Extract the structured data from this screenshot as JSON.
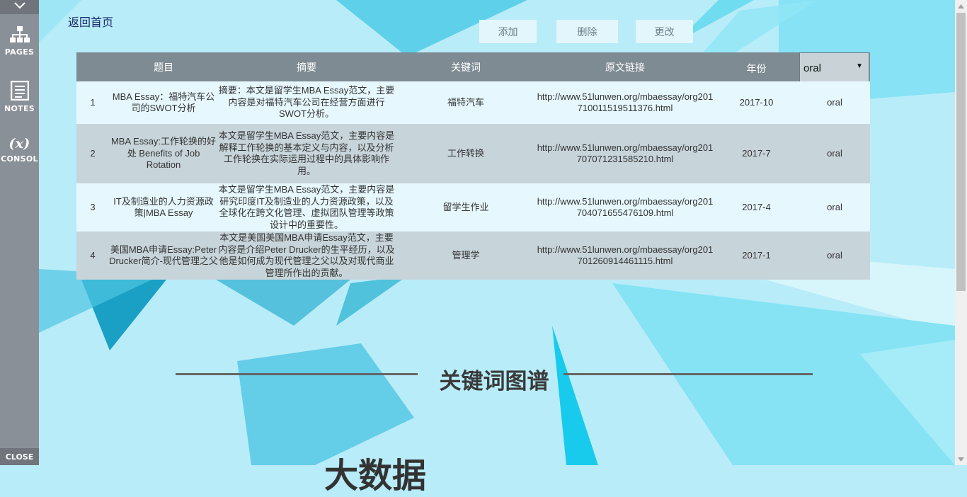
{
  "sidebar": {
    "items": [
      {
        "label": "PAGES",
        "icon": "sitemap-icon"
      },
      {
        "label": "NOTES",
        "icon": "notes-icon"
      },
      {
        "label": "CONSOL",
        "icon": "function-x-icon",
        "glyph": "(x)"
      }
    ],
    "close_label": "CLOSE"
  },
  "header": {
    "home_link": "返回首页",
    "buttons": {
      "add": "添加",
      "delete": "删除",
      "edit": "更改"
    }
  },
  "table": {
    "columns": {
      "title": "题目",
      "abstract": "摘要",
      "keyword": "关键词",
      "link": "原文链接",
      "year": "年份"
    },
    "filter_value": "oral",
    "rows": [
      {
        "no": "1",
        "title": "MBA Essay：福特汽车公司的SWOT分析",
        "abstract": "摘要：本文是留学生MBA Essay范文，主要内容是对福特汽车公司在经营方面进行SWOT分析。",
        "keyword": "福特汽车",
        "link": "http://www.51lunwen.org/mbaessay/org201710011519511376.html",
        "year": "2017-10",
        "type": "oral"
      },
      {
        "no": "2",
        "title": "MBA Essay:工作轮换的好处 Benefits of Job Rotation",
        "abstract": "本文是留学生MBA Essay范文，主要内容是解释工作轮换的基本定义与内容，以及分析工作轮换在实际运用过程中的具体影响作用。",
        "keyword": "工作转换",
        "link": "http://www.51lunwen.org/mbaessay/org201707071231585210.html",
        "year": "2017-7",
        "type": "oral"
      },
      {
        "no": "3",
        "title": "IT及制造业的人力资源政策|MBA Essay",
        "abstract": "本文是留学生MBA Essay范文，主要内容是研究印度IT及制造业的人力资源政策，以及全球化在跨文化管理、虚拟团队管理等政策设计中的重要性。",
        "keyword": "留学生作业",
        "link": "http://www.51lunwen.org/mbaessay/org201704071655476109.html",
        "year": "2017-4",
        "type": "oral"
      },
      {
        "no": "4",
        "title": "美国MBA申请Essay:Peter Drucker简介-现代管理之父",
        "abstract": "本文是美国美国MBA申请Essay范文，主要内容是介绍Peter Drucker的生平经历，以及他是如何成为现代管理之父以及对现代商业管理所作出的贡献。",
        "keyword": "管理学",
        "link": "http://www.51lunwen.org/mbaessay/org201701260914461115.html",
        "year": "2017-1",
        "type": "oral"
      }
    ]
  },
  "section": {
    "title": "关键词图谱",
    "big_text": "大数据"
  },
  "colors": {
    "background": "#b8ecf8",
    "accent": "#1fc9e8",
    "header": "#7e8b92"
  }
}
